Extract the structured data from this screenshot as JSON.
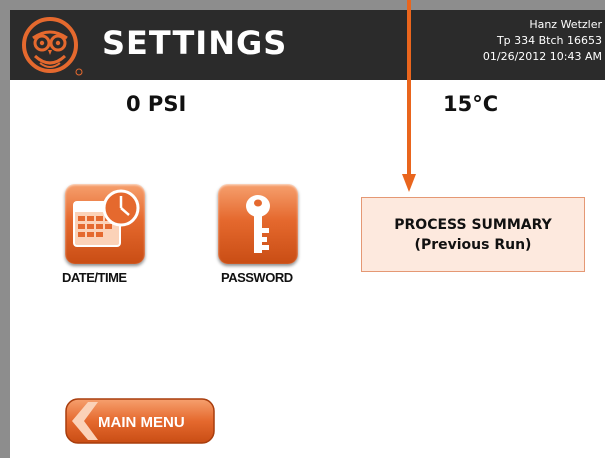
{
  "header": {
    "title": "SETTINGS",
    "user_name": "Hanz Wetzler",
    "batch": "Tp 334 Btch 16653",
    "datetime": "01/26/2012 10:43 AM"
  },
  "readings": {
    "pressure": "0 PSI",
    "temperature": "15°C"
  },
  "buttons": {
    "date_time": "DATE/TIME",
    "password": "PASSWORD",
    "summary_line1": "PROCESS SUMMARY",
    "summary_line2": "(Previous Run)",
    "main_menu": "MAIN MENU"
  },
  "icons": {
    "logo": "owl-logo-icon",
    "date_time": "calendar-clock-icon",
    "password": "key-icon",
    "main_menu": "back-arrow-icon",
    "annotation": "arrow-down-icon"
  },
  "colors": {
    "header_bg": "#2b2b2b",
    "accent": "#e5692e",
    "annotation_arrow": "#e9651d",
    "summary_bg": "#fde9de"
  }
}
